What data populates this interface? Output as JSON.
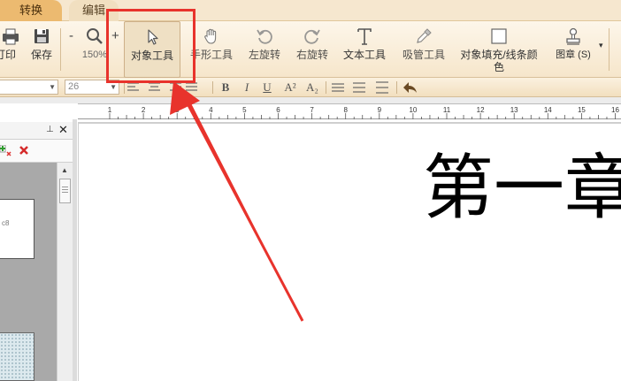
{
  "tabs": [
    {
      "label": "转换"
    },
    {
      "label": "编辑"
    }
  ],
  "toolbar": {
    "print_label": "打印",
    "save_label": "保存",
    "zoom_minus": "-",
    "zoom_plus": "+",
    "zoom_value": "150%",
    "object_tool_label": "对象工具",
    "hand_tool_label": "手形工具",
    "rotate_left_label": "左旋转",
    "rotate_right_label": "右旋转",
    "text_tool_label": "文本工具",
    "eyedropper_label": "吸管工具",
    "fill_color_label": "对象填充/线条颜色",
    "stamp_label": "图章 (S)",
    "more_arrow": "▾"
  },
  "format_bar": {
    "font_size": "26",
    "font_name": "",
    "bold": "B",
    "italic": "I",
    "underline": "U",
    "superscript": "A²",
    "subscript": "A₂"
  },
  "left_pane": {
    "pin": "⊥",
    "close": "✕",
    "thumb_text": "c8"
  },
  "ruler": {
    "labels": [
      "1",
      "2",
      "3",
      "4",
      "5",
      "6",
      "7",
      "8",
      "9",
      "10",
      "11",
      "12",
      "13",
      "14",
      "15",
      "16"
    ]
  },
  "document": {
    "chapter_text": "第一章"
  },
  "annotation": {
    "highlight_color": "#e8332c",
    "arrow_color": "#e8332c"
  }
}
